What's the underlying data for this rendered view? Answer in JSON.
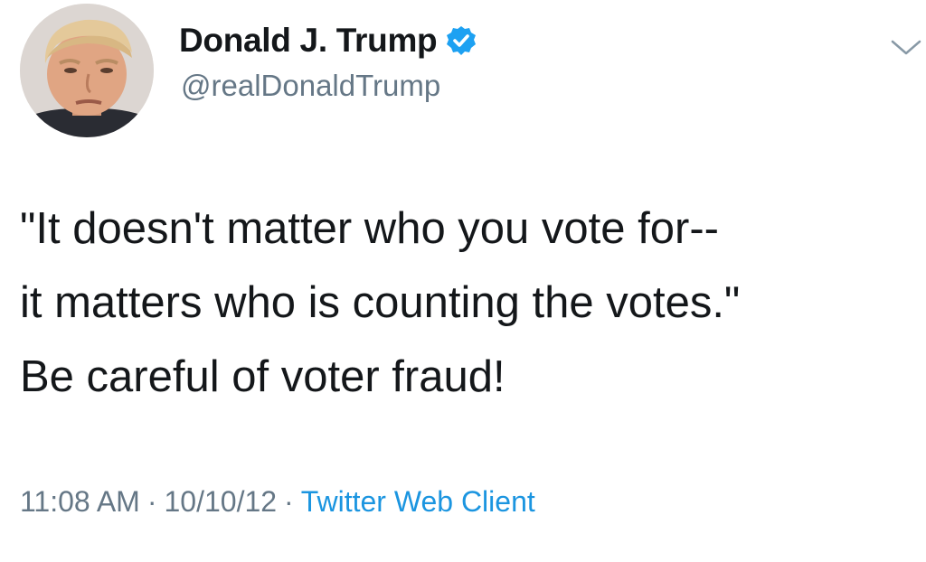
{
  "author": {
    "display_name": "Donald J. Trump",
    "handle": "@realDonaldTrump",
    "verified": true,
    "avatar_icon": "profile-photo"
  },
  "tweet": {
    "lines": [
      "\"It doesn't matter who you vote for--",
      "it matters who is counting the votes.\"",
      "Be careful of voter fraud!"
    ]
  },
  "meta": {
    "time": "11:08 AM",
    "separator": "·",
    "date": "10/10/12",
    "source": "Twitter Web Client"
  },
  "colors": {
    "text": "#14171a",
    "secondary_text": "#657786",
    "link": "#1b95e0",
    "verified_badge": "#1da1f2"
  },
  "icons": {
    "verified": "verified-badge-icon",
    "menu": "chevron-down-icon"
  }
}
